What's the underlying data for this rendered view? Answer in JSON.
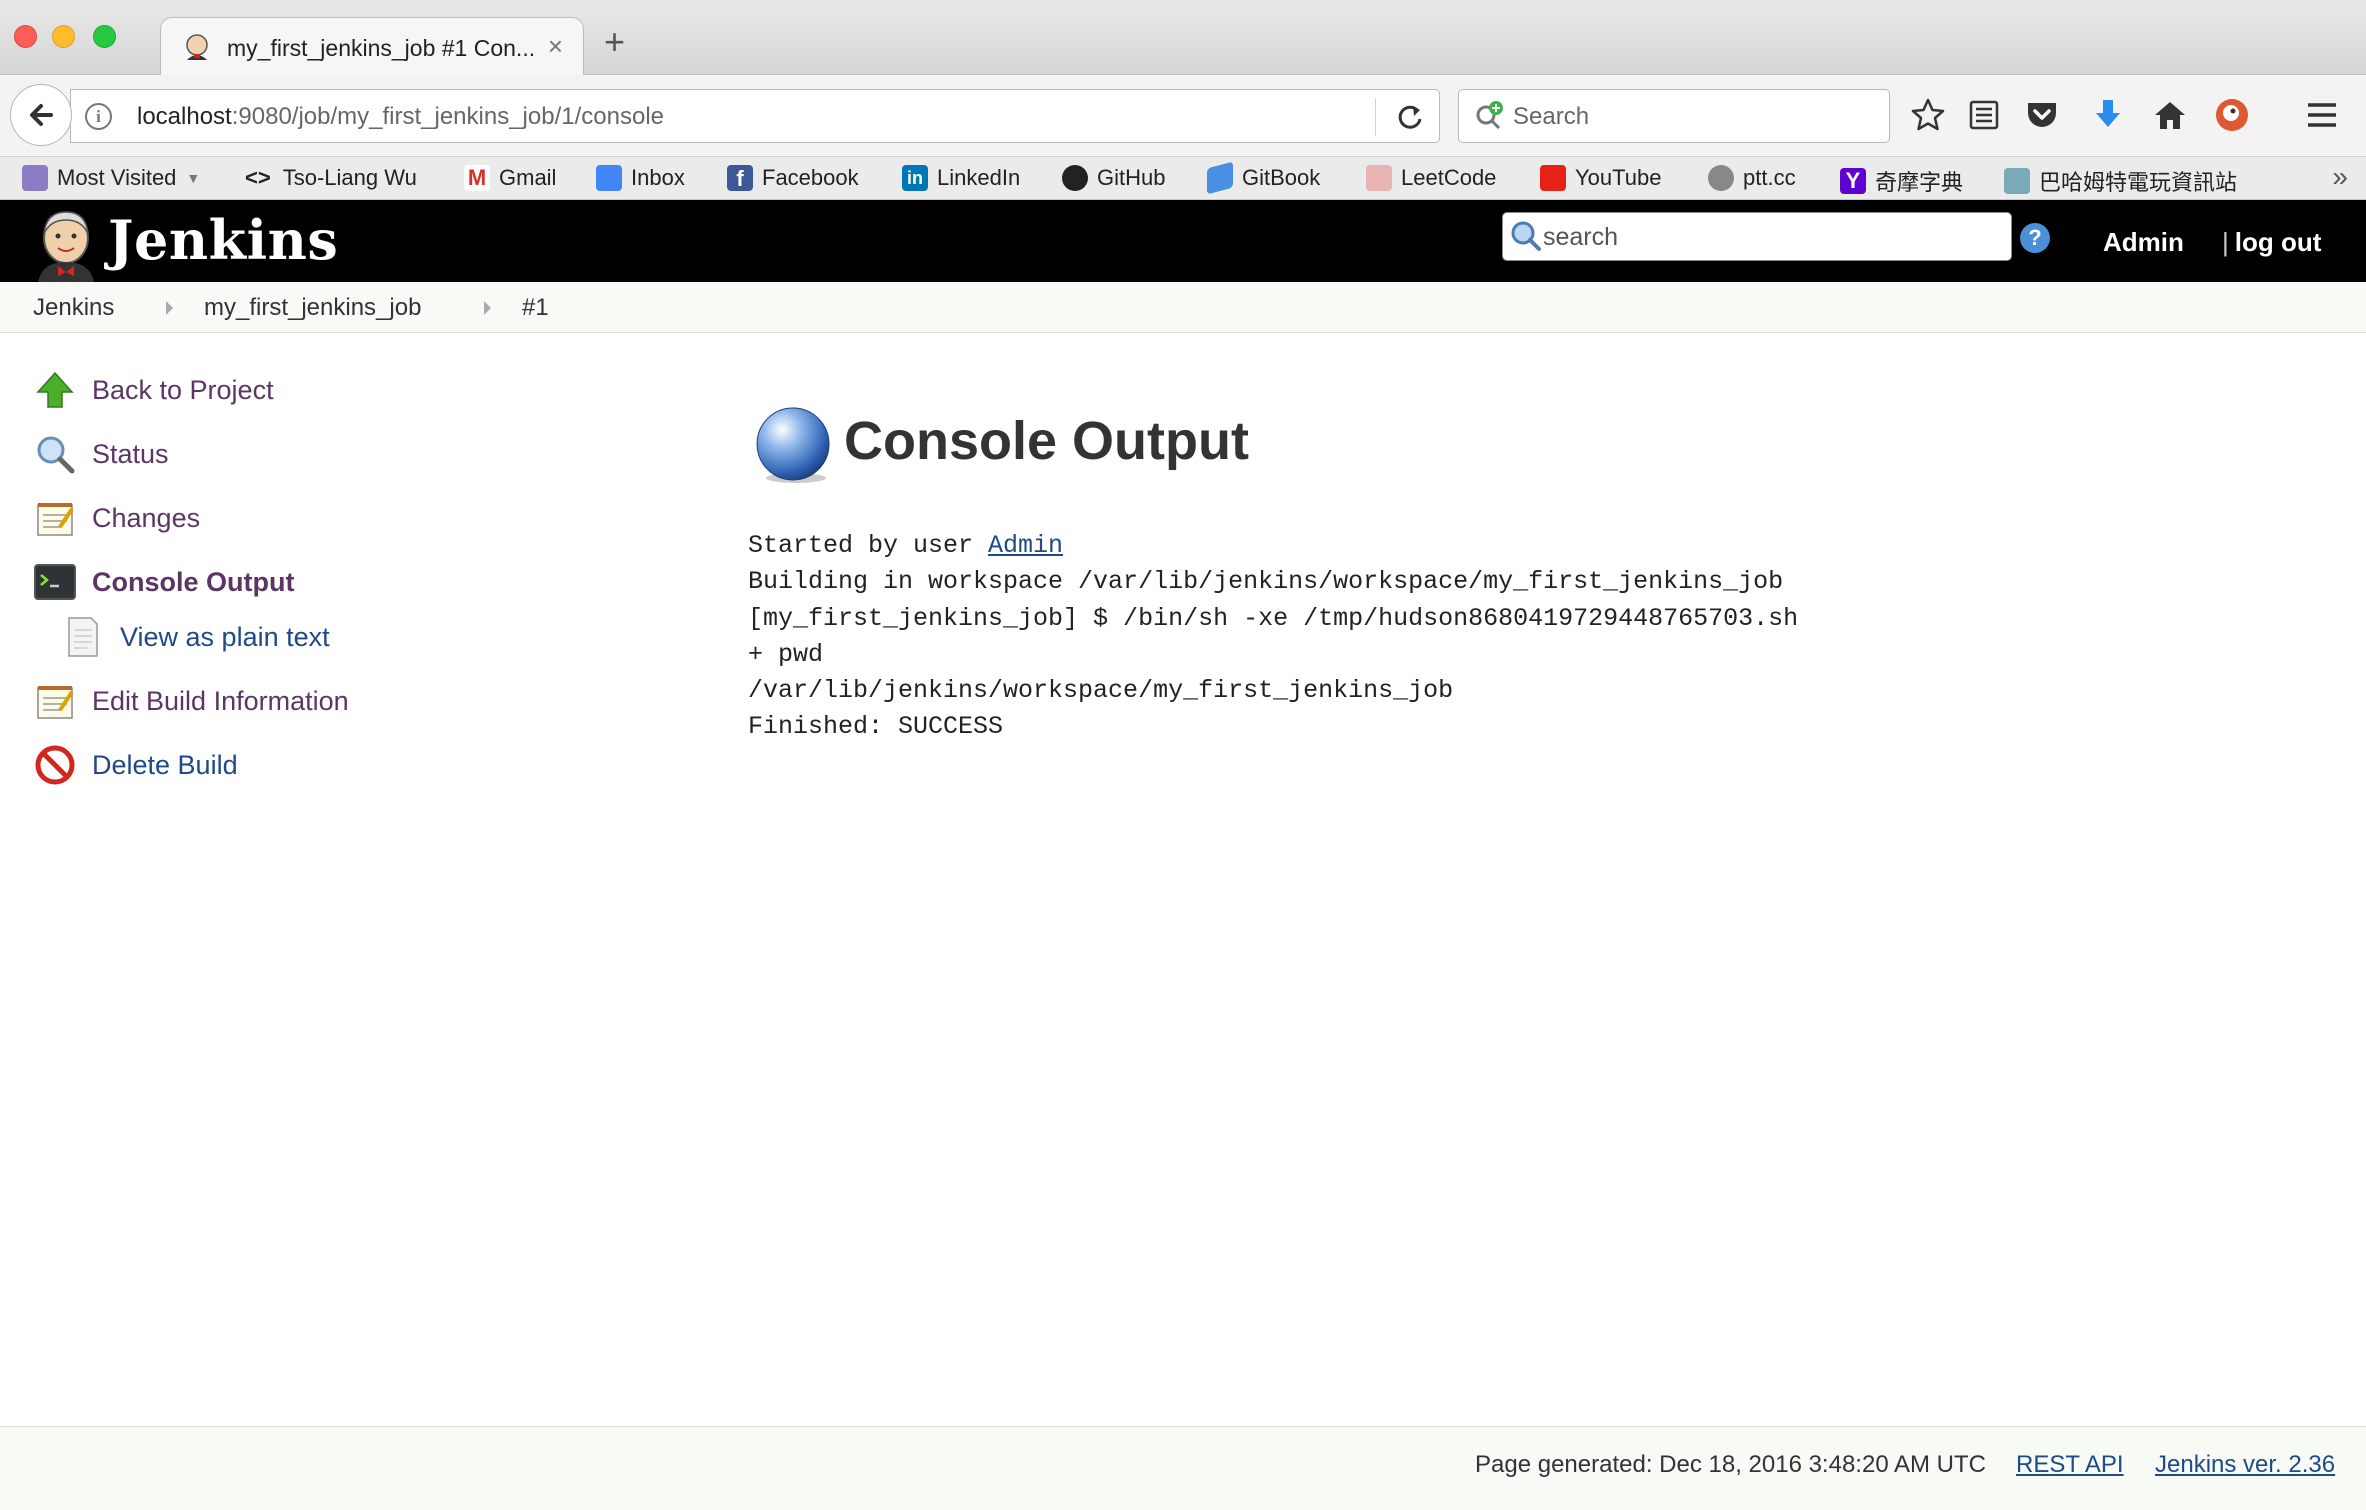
{
  "browser": {
    "tab_title": "my_first_jenkins_job #1 Con...",
    "tab_close": "×",
    "new_tab": "+",
    "url_host": "localhost",
    "url_rest": ":9080/job/my_first_jenkins_job/1/console",
    "search_placeholder": "Search",
    "bookmarks": [
      {
        "label": "Most Visited",
        "icon": "folder-icon",
        "dropdown": true
      },
      {
        "label": "Tso-Liang Wu",
        "icon": "code-icon"
      },
      {
        "label": "Gmail",
        "icon": "gmail-icon"
      },
      {
        "label": "Inbox",
        "icon": "inbox-icon"
      },
      {
        "label": "Facebook",
        "icon": "facebook-icon"
      },
      {
        "label": "LinkedIn",
        "icon": "linkedin-icon"
      },
      {
        "label": "GitHub",
        "icon": "github-icon"
      },
      {
        "label": "GitBook",
        "icon": "gitbook-icon"
      },
      {
        "label": "LeetCode",
        "icon": "leetcode-icon"
      },
      {
        "label": "YouTube",
        "icon": "youtube-icon"
      },
      {
        "label": "ptt.cc",
        "icon": "globe-icon"
      },
      {
        "label": "奇摩字典",
        "icon": "yahoo-icon"
      },
      {
        "label": "巴哈姆特電玩資訊站",
        "icon": "bahamut-icon"
      }
    ],
    "bookmarks_overflow": "»"
  },
  "jenkins": {
    "logo_text": "Jenkins",
    "search_placeholder": "search",
    "help": "?",
    "user": "Admin",
    "logout_sep": "|",
    "logout": "log out"
  },
  "breadcrumb": [
    "Jenkins",
    "my_first_jenkins_job",
    "#1"
  ],
  "sidebar": {
    "items": [
      {
        "label": "Back to Project",
        "icon": "up-arrow-icon"
      },
      {
        "label": "Status",
        "icon": "magnifier-icon"
      },
      {
        "label": "Changes",
        "icon": "notepad-icon"
      },
      {
        "label": "Console Output",
        "icon": "terminal-icon",
        "active": true
      },
      {
        "label": "View as plain text",
        "icon": "document-icon"
      },
      {
        "label": "Edit Build Information",
        "icon": "notepad-icon"
      },
      {
        "label": "Delete Build",
        "icon": "no-entry-icon"
      }
    ]
  },
  "main": {
    "title": "Console Output",
    "status_icon": "blue-ball-icon",
    "console": {
      "started_prefix": "Started by user ",
      "started_user": "Admin",
      "lines": [
        "Building in workspace /var/lib/jenkins/workspace/my_first_jenkins_job",
        "[my_first_jenkins_job] $ /bin/sh -xe /tmp/hudson8680419729448765703.sh",
        "+ pwd",
        "/var/lib/jenkins/workspace/my_first_jenkins_job",
        "Finished: SUCCESS"
      ]
    }
  },
  "footer": {
    "generated": "Page generated: Dec 18, 2016 3:48:20 AM UTC",
    "rest_api": "REST API",
    "version": "Jenkins ver. 2.36"
  },
  "colors": {
    "jenkins_header": "#000000",
    "link_purple": "#5c3566",
    "link_blue": "#204a87"
  }
}
